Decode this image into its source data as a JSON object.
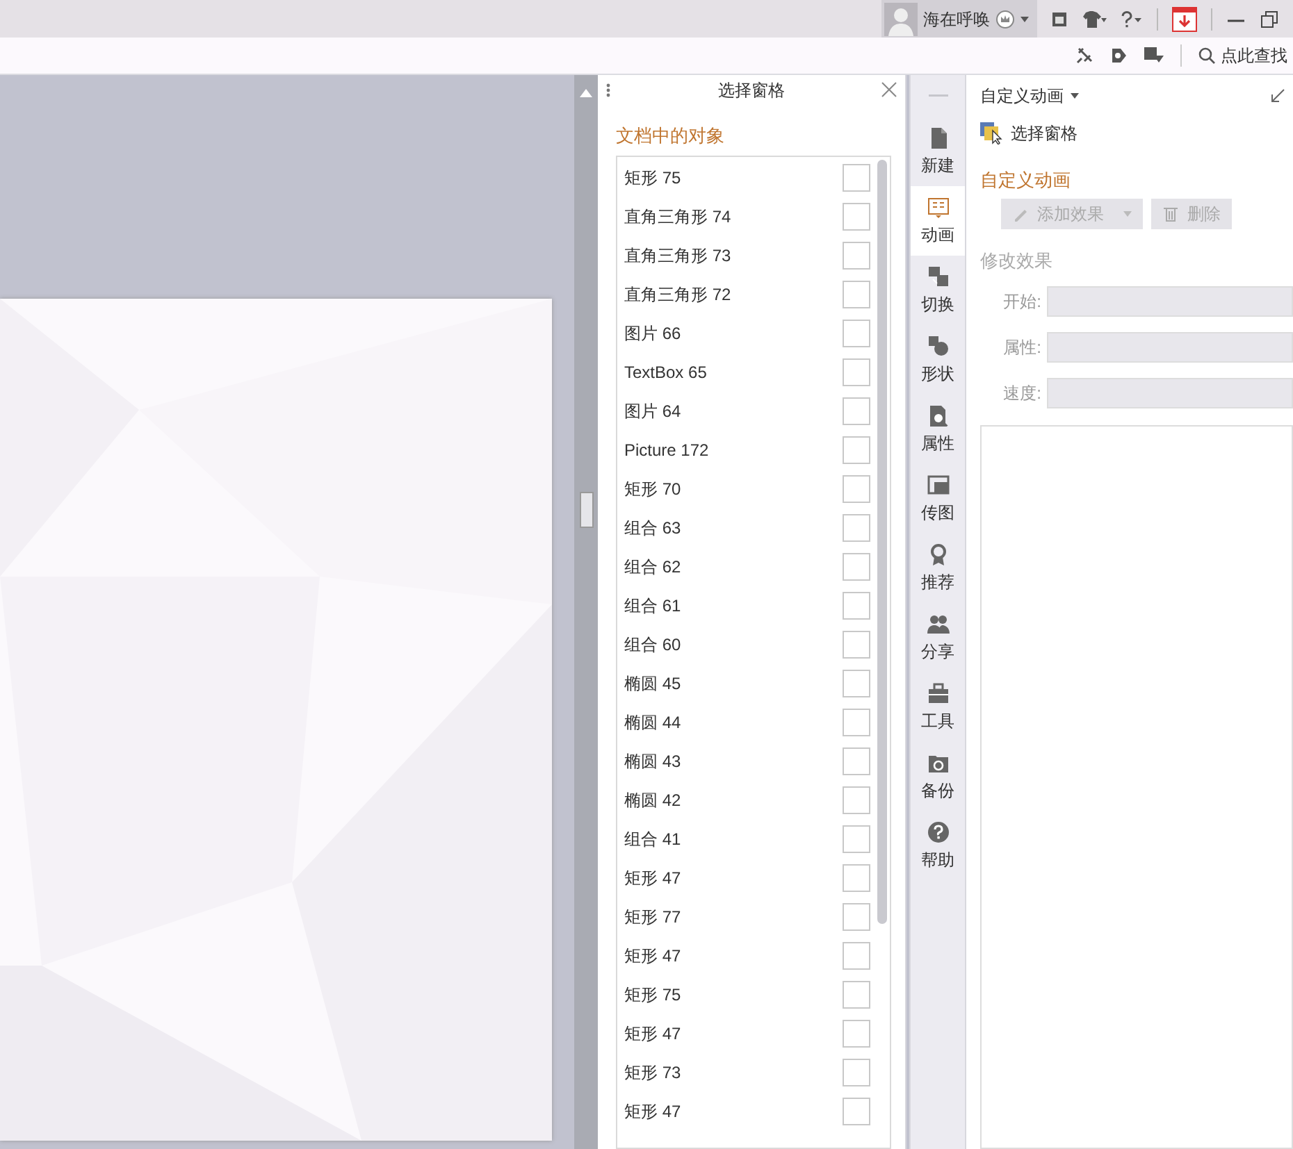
{
  "title_bar": {
    "user_name": "海在呼唤"
  },
  "toolbar": {
    "search": {
      "placeholder": "点此查找"
    }
  },
  "selection_pane": {
    "title": "选择窗格",
    "section_title": "文档中的对象",
    "objects": [
      {
        "name": "矩形 75",
        "checked": false
      },
      {
        "name": "直角三角形 74",
        "checked": false
      },
      {
        "name": "直角三角形 73",
        "checked": false
      },
      {
        "name": "直角三角形 72",
        "checked": false
      },
      {
        "name": "图片 66",
        "checked": false
      },
      {
        "name": "TextBox 65",
        "checked": false
      },
      {
        "name": "图片 64",
        "checked": false
      },
      {
        "name": "Picture 172",
        "checked": false
      },
      {
        "name": "矩形 70",
        "checked": false
      },
      {
        "name": "组合 63",
        "checked": false
      },
      {
        "name": "组合 62",
        "checked": false
      },
      {
        "name": "组合 61",
        "checked": false
      },
      {
        "name": "组合 60",
        "checked": false
      },
      {
        "name": "椭圆 45",
        "checked": false
      },
      {
        "name": "椭圆 44",
        "checked": false
      },
      {
        "name": "椭圆 43",
        "checked": false
      },
      {
        "name": "椭圆 42",
        "checked": false
      },
      {
        "name": "组合 41",
        "checked": false
      },
      {
        "name": "矩形 47",
        "checked": false
      },
      {
        "name": "矩形 77",
        "checked": false
      },
      {
        "name": "矩形 47",
        "checked": false
      },
      {
        "name": "矩形 75",
        "checked": false
      },
      {
        "name": "矩形 47",
        "checked": false
      },
      {
        "name": "矩形 73",
        "checked": false
      },
      {
        "name": "矩形 47",
        "checked": false
      }
    ]
  },
  "side_rail": {
    "items": [
      {
        "label": "新建",
        "kind": "file",
        "selected": false
      },
      {
        "label": "动画",
        "kind": "animation",
        "selected": true
      },
      {
        "label": "切换",
        "kind": "transition",
        "selected": false
      },
      {
        "label": "形状",
        "kind": "shape",
        "selected": false
      },
      {
        "label": "属性",
        "kind": "property",
        "selected": false
      },
      {
        "label": "传图",
        "kind": "image",
        "selected": false
      },
      {
        "label": "推荐",
        "kind": "award",
        "selected": false
      },
      {
        "label": "分享",
        "kind": "people",
        "selected": false
      },
      {
        "label": "工具",
        "kind": "toolbox",
        "selected": false
      },
      {
        "label": "备份",
        "kind": "backup",
        "selected": false
      },
      {
        "label": "帮助",
        "kind": "help",
        "selected": false
      }
    ]
  },
  "animation_panel": {
    "title": "自定义动画",
    "selection_pane_link": "选择窗格",
    "section_title": "自定义动画",
    "buttons": [
      {
        "label": "添加效果",
        "kind": "add",
        "disabled": true
      },
      {
        "label": "删除",
        "kind": "delete",
        "disabled": true
      }
    ],
    "modify_title": "修改效果",
    "fields": [
      {
        "label": "开始:",
        "disabled": true
      },
      {
        "label": "属性:",
        "disabled": true
      },
      {
        "label": "速度:",
        "disabled": true
      }
    ]
  }
}
